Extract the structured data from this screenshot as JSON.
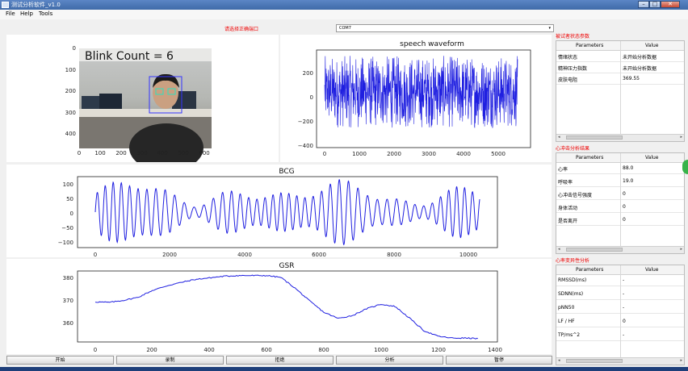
{
  "window": {
    "title": "测试分析软件_v1.0",
    "min": "–",
    "max": "□",
    "close": "✕"
  },
  "menu": [
    "File",
    "Help",
    "Tools"
  ],
  "hint": "请选择正确端口",
  "port": {
    "value": "COM7",
    "arrow": "▾"
  },
  "plots": {
    "image": {
      "overlay": "Blink Count = 6",
      "xticks": [
        "0",
        "100",
        "200",
        "300",
        "400",
        "500",
        "600"
      ],
      "yticks": [
        "0",
        "100",
        "200",
        "300",
        "400"
      ]
    },
    "speech": {
      "title": "speech waveform",
      "xticks": [
        "0",
        "1000",
        "2000",
        "3000",
        "4000",
        "5000"
      ],
      "yticks": [
        "200",
        "0",
        "−200",
        "−400"
      ]
    },
    "bcg": {
      "title": "BCG",
      "xticks": [
        "0",
        "2000",
        "4000",
        "6000",
        "8000",
        "10000"
      ],
      "yticks": [
        "100",
        "50",
        "0",
        "−50",
        "−100"
      ]
    },
    "gsr": {
      "title": "GSR",
      "xticks": [
        "0",
        "200",
        "400",
        "600",
        "800",
        "1000",
        "1200",
        "1400"
      ],
      "yticks": [
        "380",
        "370",
        "360"
      ]
    }
  },
  "chart_data": [
    {
      "type": "line",
      "title": "speech waveform",
      "x_range": [
        0,
        5500
      ],
      "y_range": [
        -400,
        300
      ],
      "description_series": "dense noise waveform"
    },
    {
      "type": "line",
      "title": "BCG",
      "x_range": [
        0,
        10300
      ],
      "y_range": [
        -110,
        110
      ]
    },
    {
      "type": "line",
      "title": "GSR",
      "x": [
        0,
        50,
        100,
        150,
        200,
        250,
        300,
        350,
        400,
        450,
        500,
        550,
        600,
        650,
        700,
        750,
        800,
        850,
        900,
        950,
        1000,
        1050,
        1100,
        1150,
        1200,
        1250,
        1300,
        1340
      ],
      "y": [
        369.5,
        369.3,
        370.2,
        371.5,
        374.5,
        376.5,
        378,
        379.3,
        380,
        380.7,
        381,
        381,
        381,
        380.2,
        375.5,
        370,
        365,
        362.3,
        363.5,
        366.5,
        368.5,
        367.5,
        362.5,
        357,
        354.5,
        353.7,
        353.7,
        353.5
      ]
    }
  ],
  "tables": [
    {
      "title": "被试者状态参数",
      "col1": "Parameters",
      "col2": "Value",
      "rows": [
        [
          "情绪状态",
          "未开始分析数据"
        ],
        [
          "精神压力指数",
          "未开始分析数据"
        ],
        [
          "皮肤电阻",
          "369.55"
        ]
      ]
    },
    {
      "title": "心冲击分析结果",
      "col1": "Parameters",
      "col2": "Value",
      "rows": [
        [
          "心率",
          "88.0"
        ],
        [
          "呼吸率",
          "19.0"
        ],
        [
          "心冲击信号强度",
          "0"
        ],
        [
          "身体活动",
          "0"
        ],
        [
          "是否离开",
          "0"
        ]
      ]
    },
    {
      "title": "心率变异性分析",
      "col1": "Parameters",
      "col2": "Value",
      "rows": [
        [
          "RMSSD(ms)",
          "-"
        ],
        [
          "SDNN(ms)",
          "-"
        ],
        [
          "pNN50",
          "-"
        ],
        [
          "LF / HF",
          "0"
        ],
        [
          "TP/ms^2",
          "-"
        ]
      ]
    }
  ],
  "buttons": [
    "开始",
    "录制",
    "拒绝",
    "分析",
    "暂停"
  ],
  "colors": {
    "line": "#1f1fe0",
    "hint": "#e00000"
  }
}
